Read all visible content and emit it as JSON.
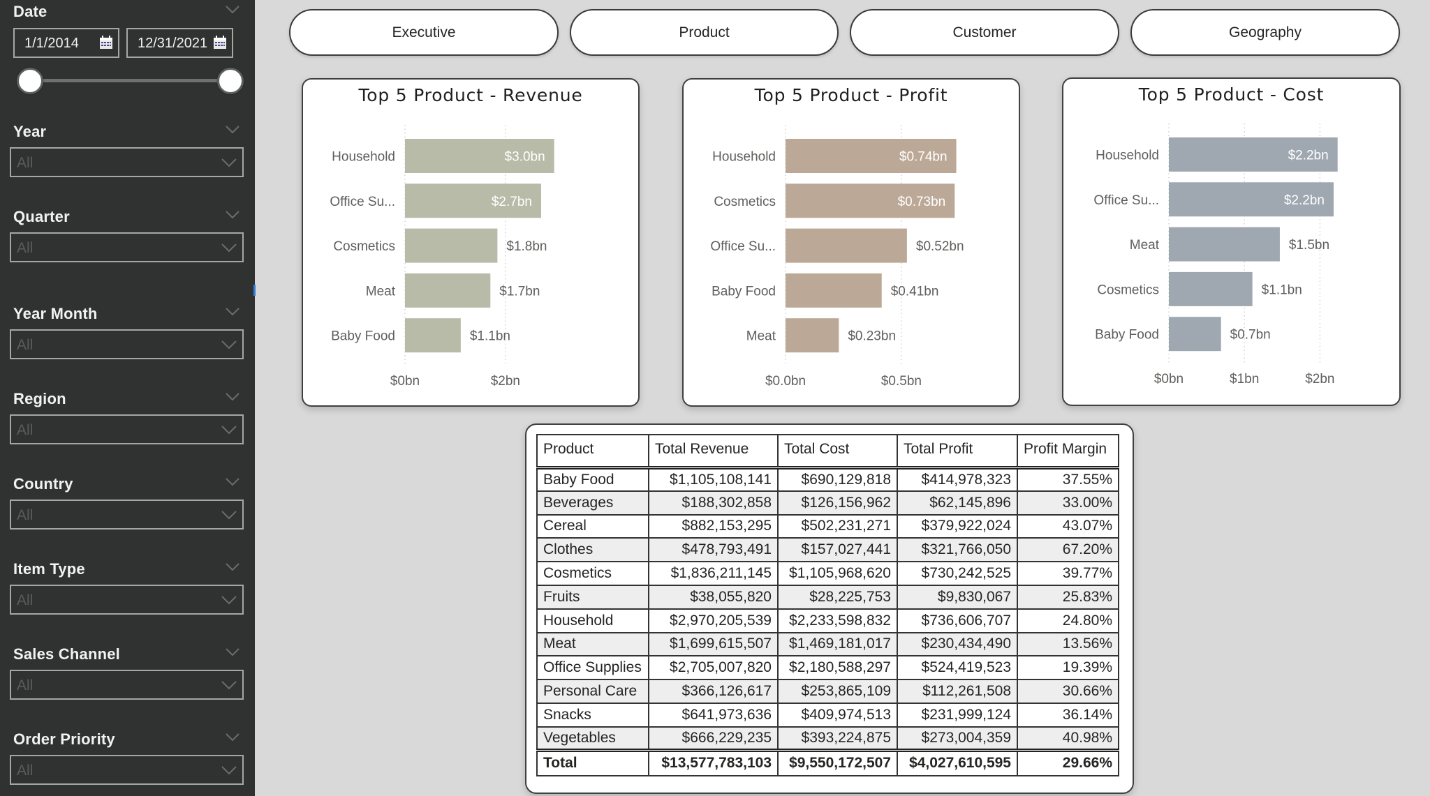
{
  "sidebar": {
    "date": {
      "title": "Date",
      "start": "1/1/2014",
      "end": "12/31/2021",
      "range_selected_fraction": [
        0.0,
        1.0
      ]
    },
    "slicers": [
      {
        "title": "Year",
        "value": "All"
      },
      {
        "title": "Quarter",
        "value": "All"
      },
      {
        "title": "Year Month",
        "value": "All"
      },
      {
        "title": "Region",
        "value": "All"
      },
      {
        "title": "Country",
        "value": "All"
      },
      {
        "title": "Item Type",
        "value": "All"
      },
      {
        "title": "Sales Channel",
        "value": "All"
      },
      {
        "title": "Order Priority",
        "value": "All"
      }
    ]
  },
  "nav": {
    "buttons": [
      {
        "label": "Executive"
      },
      {
        "label": "Product"
      },
      {
        "label": "Customer"
      },
      {
        "label": "Geography"
      }
    ]
  },
  "colors": {
    "revenue_bar": "#b8bba8",
    "profit_bar": "#bba896",
    "cost_bar": "#9fa8b0",
    "sidebar_bg": "#2f3230",
    "page_bg": "#d9d9d9",
    "scroll_indicator": "#2d7fd6"
  },
  "chart_data": [
    {
      "type": "bar",
      "orientation": "horizontal",
      "title": "Top 5 Product - Revenue",
      "categories": [
        "Household",
        "Office Su...",
        "Cosmetics",
        "Meat",
        "Baby Food"
      ],
      "values": [
        2.97,
        2.71,
        1.84,
        1.7,
        1.11
      ],
      "data_labels": [
        "$3.0bn",
        "$2.7bn",
        "$1.8bn",
        "$1.7bn",
        "$1.1bn"
      ],
      "label_inside": [
        true,
        true,
        false,
        false,
        false
      ],
      "x_ticks": [
        0,
        2
      ],
      "x_tick_labels": [
        "$0bn",
        "$2bn"
      ],
      "xlim": [
        0,
        3.6
      ],
      "xlabel": "",
      "ylabel": "",
      "grid": "vertical dotted",
      "color_key": "revenue_bar"
    },
    {
      "type": "bar",
      "orientation": "horizontal",
      "title": "Top 5 Product - Profit",
      "categories": [
        "Household",
        "Cosmetics",
        "Office Su...",
        "Baby Food",
        "Meat"
      ],
      "values": [
        0.737,
        0.73,
        0.524,
        0.415,
        0.23
      ],
      "data_labels": [
        "$0.74bn",
        "$0.73bn",
        "$0.52bn",
        "$0.41bn",
        "$0.23bn"
      ],
      "label_inside": [
        true,
        true,
        false,
        false,
        false
      ],
      "x_ticks": [
        0,
        0.5
      ],
      "x_tick_labels": [
        "$0.0bn",
        "$0.5bn"
      ],
      "xlim": [
        0,
        0.91
      ],
      "xlabel": "",
      "ylabel": "",
      "grid": "vertical dotted",
      "color_key": "profit_bar"
    },
    {
      "type": "bar",
      "orientation": "horizontal",
      "title": "Top 5 Product - Cost",
      "categories": [
        "Household",
        "Office Su...",
        "Meat",
        "Cosmetics",
        "Baby Food"
      ],
      "values": [
        2.234,
        2.181,
        1.469,
        1.106,
        0.69
      ],
      "data_labels": [
        "$2.2bn",
        "$2.2bn",
        "$1.5bn",
        "$1.1bn",
        "$0.7bn"
      ],
      "label_inside": [
        true,
        true,
        false,
        false,
        false
      ],
      "x_ticks": [
        0,
        1,
        2
      ],
      "x_tick_labels": [
        "$0bn",
        "$1bn",
        "$2bn"
      ],
      "xlim": [
        0,
        2.93
      ],
      "xlabel": "",
      "ylabel": "",
      "grid": "vertical dotted",
      "color_key": "cost_bar"
    },
    {
      "type": "table",
      "columns": [
        "Product",
        "Total Revenue",
        "Total Cost",
        "Total Profit",
        "Profit Margin"
      ],
      "rows": [
        [
          "Baby Food",
          "$1,105,108,141",
          "$690,129,818",
          "$414,978,323",
          "37.55%"
        ],
        [
          "Beverages",
          "$188,302,858",
          "$126,156,962",
          "$62,145,896",
          "33.00%"
        ],
        [
          "Cereal",
          "$882,153,295",
          "$502,231,271",
          "$379,922,024",
          "43.07%"
        ],
        [
          "Clothes",
          "$478,793,491",
          "$157,027,441",
          "$321,766,050",
          "67.20%"
        ],
        [
          "Cosmetics",
          "$1,836,211,145",
          "$1,105,968,620",
          "$730,242,525",
          "39.77%"
        ],
        [
          "Fruits",
          "$38,055,820",
          "$28,225,753",
          "$9,830,067",
          "25.83%"
        ],
        [
          "Household",
          "$2,970,205,539",
          "$2,233,598,832",
          "$736,606,707",
          "24.80%"
        ],
        [
          "Meat",
          "$1,699,615,507",
          "$1,469,181,017",
          "$230,434,490",
          "13.56%"
        ],
        [
          "Office Supplies",
          "$2,705,007,820",
          "$2,180,588,297",
          "$524,419,523",
          "19.39%"
        ],
        [
          "Personal Care",
          "$366,126,617",
          "$253,865,109",
          "$112,261,508",
          "30.66%"
        ],
        [
          "Snacks",
          "$641,973,636",
          "$409,974,513",
          "$231,999,124",
          "36.14%"
        ],
        [
          "Vegetables",
          "$666,229,235",
          "$393,224,875",
          "$273,004,359",
          "40.98%"
        ]
      ],
      "total": [
        "Total",
        "$13,577,783,103",
        "$9,550,172,507",
        "$4,027,610,595",
        "29.66%"
      ]
    }
  ]
}
